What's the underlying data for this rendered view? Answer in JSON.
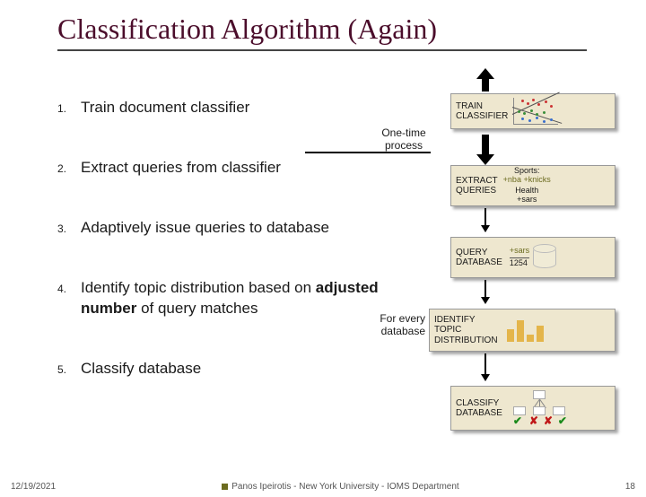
{
  "title": "Classification Algorithm (Again)",
  "steps": [
    {
      "num": "1.",
      "text": "Train document classifier"
    },
    {
      "num": "2.",
      "text": "Extract queries from classifier"
    },
    {
      "num": "3.",
      "text": "Adaptively issue queries to database"
    },
    {
      "num": "4.",
      "text_pre": "Identify topic distribution based on ",
      "bold": "adjusted number",
      "text_post": " of query matches"
    },
    {
      "num": "5.",
      "text": "Classify database"
    }
  ],
  "one_time": "One-time process",
  "box1": {
    "label": "TRAIN\nCLASSIFIER"
  },
  "box2": {
    "label": "EXTRACT\nQUERIES",
    "sports": "Sports:",
    "sports_kw": "+nba +knicks",
    "health": "Health\n+sars"
  },
  "box3": {
    "label": "QUERY\nDATABASE",
    "kw": "+sars",
    "count": "1254"
  },
  "box4": {
    "prefix1": "For every",
    "prefix2": "database",
    "label": "IDENTIFY\nTOPIC\nDISTRIBUTION"
  },
  "box5": {
    "label": "CLASSIFY\nDATABASE"
  },
  "footer": {
    "date": "12/19/2021",
    "center": "Panos Ipeirotis - New York University - IOMS Department",
    "page": "18"
  }
}
